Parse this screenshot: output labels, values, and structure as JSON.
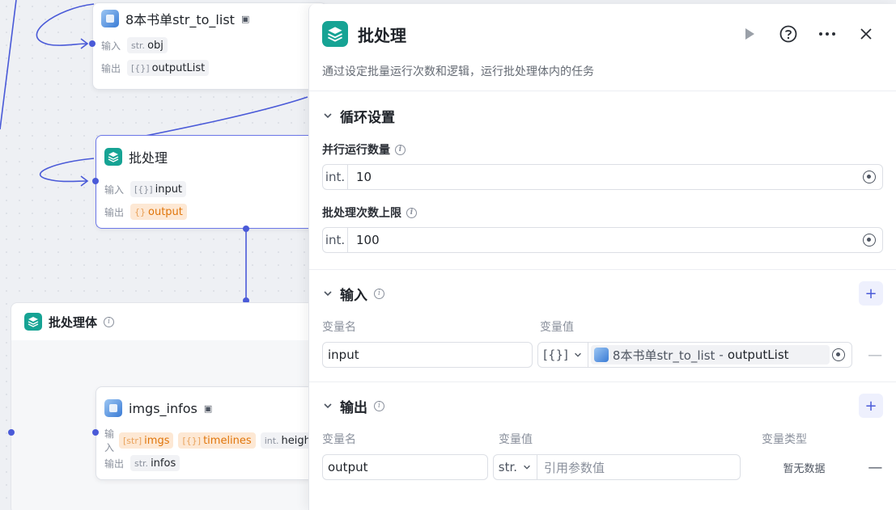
{
  "canvas": {
    "node_str_to_list": {
      "title": "8本书单str_to_list",
      "input_label": "输入",
      "input_type": "str.",
      "input_name": "obj",
      "output_label": "输出",
      "output_type": "[{}]",
      "output_name": "outputList"
    },
    "node_batch": {
      "title": "批处理",
      "input_label": "输入",
      "input_type": "[{}]",
      "input_name": "input",
      "output_label": "输出",
      "output_type": "{}",
      "output_name": "output"
    },
    "group_batch_body": {
      "title": "批处理体"
    },
    "node_imgs_infos": {
      "title": "imgs_infos",
      "input_label": "输入",
      "inputs": [
        {
          "type": "[str]",
          "name": "imgs"
        },
        {
          "type": "[{}]",
          "name": "timelines"
        },
        {
          "type": "int.",
          "name": "height"
        }
      ],
      "output_label": "输出",
      "output_type": "str.",
      "output_name": "infos"
    }
  },
  "panel": {
    "title": "批处理",
    "description": "通过设定批量运行次数和逻辑，运行批处理体内的任务",
    "loop_section": {
      "title": "循环设置",
      "parallel_label": "并行运行数量",
      "parallel_type": "int.",
      "parallel_value": "10",
      "max_label": "批处理次数上限",
      "max_type": "int.",
      "max_value": "100"
    },
    "input_section": {
      "title": "输入",
      "col_name": "变量名",
      "col_value": "变量值",
      "row": {
        "name": "input",
        "type": "[{}]",
        "ref_source": "8本书单str_to_list",
        "ref_sep": "-",
        "ref_field": "outputList"
      }
    },
    "output_section": {
      "title": "输出",
      "col_name": "变量名",
      "col_value": "变量值",
      "col_type": "变量类型",
      "row": {
        "name": "output",
        "type": "str.",
        "placeholder": "引用参数值",
        "type_value": "暂无数据"
      }
    }
  },
  "colors": {
    "accent": "#4a5ad8",
    "teal": "#16a394",
    "orange": "#e0750a"
  }
}
